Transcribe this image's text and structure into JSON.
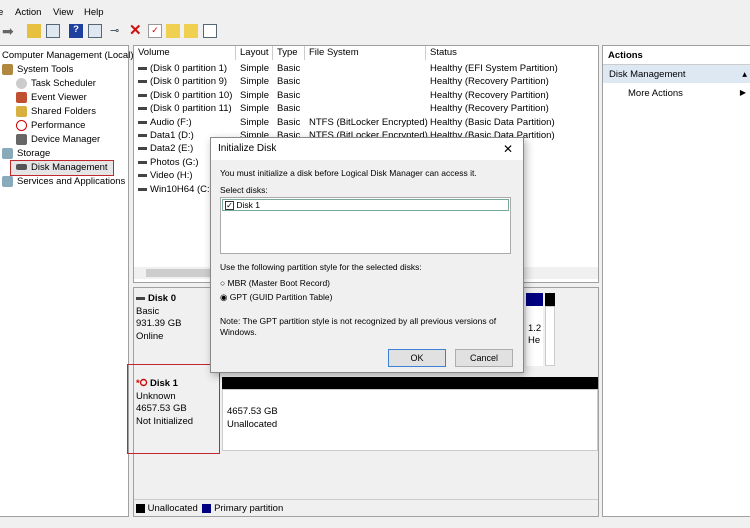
{
  "menu": {
    "file": "e",
    "action": "Action",
    "view": "View",
    "help": "Help"
  },
  "tree": {
    "root": "Computer Management (Local)",
    "system_tools": "System Tools",
    "task_scheduler": "Task Scheduler",
    "event_viewer": "Event Viewer",
    "shared_folders": "Shared Folders",
    "performance": "Performance",
    "device_manager": "Device Manager",
    "storage": "Storage",
    "disk_management": "Disk Management",
    "services": "Services and Applications"
  },
  "table": {
    "headers": [
      "Volume",
      "Layout",
      "Type",
      "File System",
      "Status"
    ],
    "rows": [
      [
        "(Disk 0 partition 1)",
        "Simple",
        "Basic",
        "",
        "Healthy (EFI System Partition)"
      ],
      [
        "(Disk 0 partition 9)",
        "Simple",
        "Basic",
        "",
        "Healthy (Recovery Partition)"
      ],
      [
        "(Disk 0 partition 10)",
        "Simple",
        "Basic",
        "",
        "Healthy (Recovery Partition)"
      ],
      [
        "(Disk 0 partition 11)",
        "Simple",
        "Basic",
        "",
        "Healthy (Recovery Partition)"
      ],
      [
        "Audio (F:)",
        "Simple",
        "Basic",
        "NTFS (BitLocker Encrypted)",
        "Healthy (Basic Data Partition)"
      ],
      [
        "Data1 (D:)",
        "Simple",
        "Basic",
        "NTFS (BitLocker Encrypted)",
        "Healthy (Basic Data Partition)"
      ],
      [
        "Data2 (E:)",
        "",
        "",
        "",
        "rtition)"
      ],
      [
        "Photos (G:)",
        "",
        "",
        "",
        "rtition)"
      ],
      [
        "Video (H:)",
        "",
        "",
        "",
        "rtition)"
      ],
      [
        "Win10H64 (C:)",
        "",
        "",
        "",
        "le, Crash Dump, Ba"
      ]
    ]
  },
  "disks": {
    "disk0": {
      "name": "Disk 0",
      "type": "Basic",
      "size": "931.39 GB",
      "state": "Online",
      "partial1": "1.2",
      "partial2": "He"
    },
    "disk1": {
      "name": "Disk 1",
      "type": "Unknown",
      "size": "4657.53 GB",
      "state": "Not Initialized",
      "part_size": "4657.53 GB",
      "part_label": "Unallocated"
    }
  },
  "legend": {
    "unallocated": "Unallocated",
    "primary": "Primary partition",
    "unallocated_color": "#000000",
    "primary_color": "#000080"
  },
  "actions": {
    "title": "Actions",
    "section": "Disk Management",
    "more": "More Actions"
  },
  "dialog": {
    "title": "Initialize Disk",
    "message": "You must initialize a disk before Logical Disk Manager can access it.",
    "select_label": "Select disks:",
    "disk_item": "Disk 1",
    "disk_checked": true,
    "style_label": "Use the following partition style for the selected disks:",
    "mbr": "MBR (Master Boot Record)",
    "gpt": "GPT (GUID Partition Table)",
    "selected": "GPT",
    "note": "Note: The GPT partition style is not recognized by all previous versions of Windows.",
    "ok": "OK",
    "cancel": "Cancel"
  }
}
